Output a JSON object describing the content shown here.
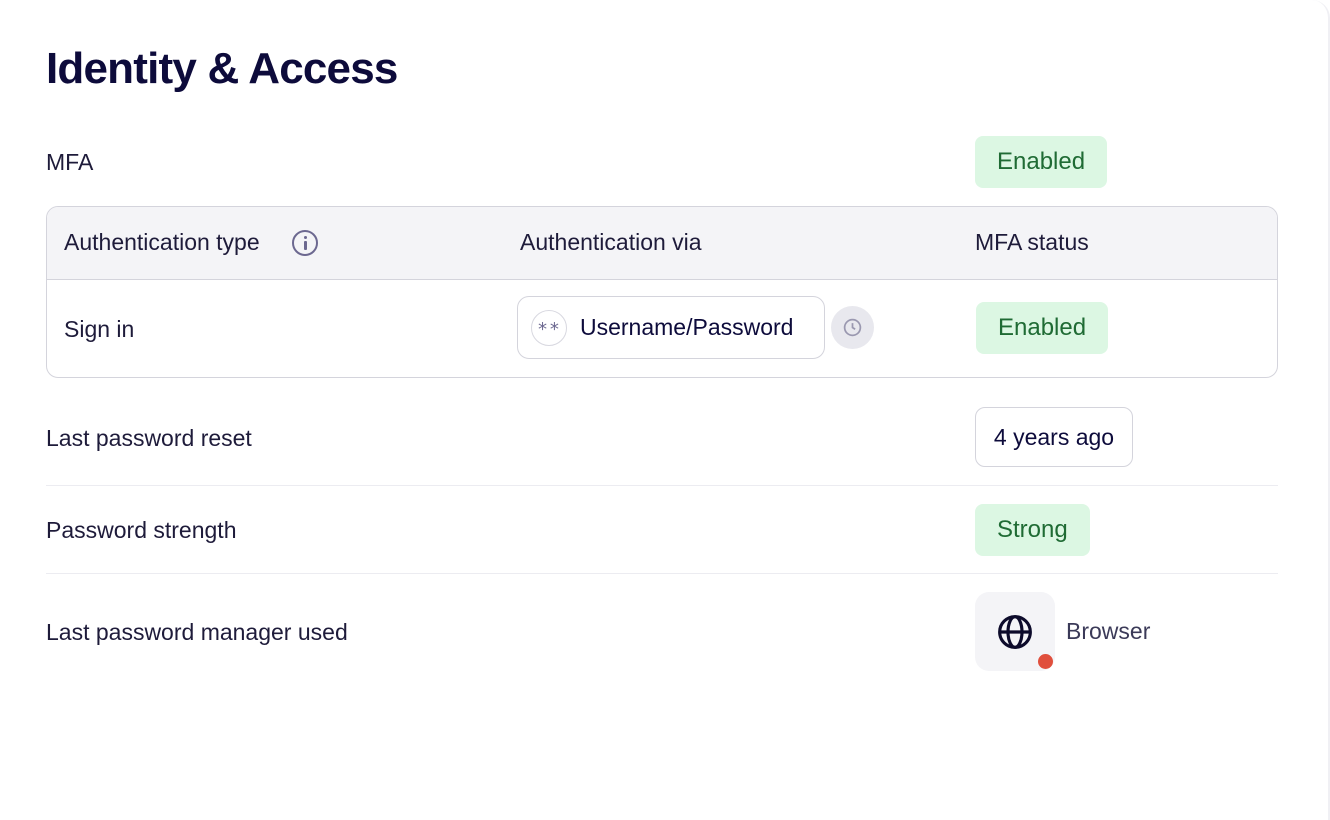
{
  "title": "Identity & Access",
  "mfa": {
    "label": "MFA",
    "status": "Enabled"
  },
  "auth_table": {
    "headers": {
      "type": "Authentication type",
      "via": "Authentication via",
      "status": "MFA status"
    },
    "icons": {
      "info": "info-icon",
      "method": "asterisks-key-icon",
      "history": "clock-icon"
    },
    "rows": [
      {
        "type": "Sign in",
        "via": "Username/Password",
        "via_icon_text": "**",
        "status": "Enabled"
      }
    ]
  },
  "last_password_reset": {
    "label": "Last password reset",
    "value": "4 years ago"
  },
  "password_strength": {
    "label": "Password strength",
    "value": "Strong"
  },
  "password_manager": {
    "label": "Last password manager used",
    "value": "Browser",
    "icon": "globe-icon",
    "status_dot_color": "#e04f3d"
  },
  "colors": {
    "success_bg": "#dcf7e3",
    "success_text": "#1f6b34",
    "title": "#0d0b3b"
  }
}
